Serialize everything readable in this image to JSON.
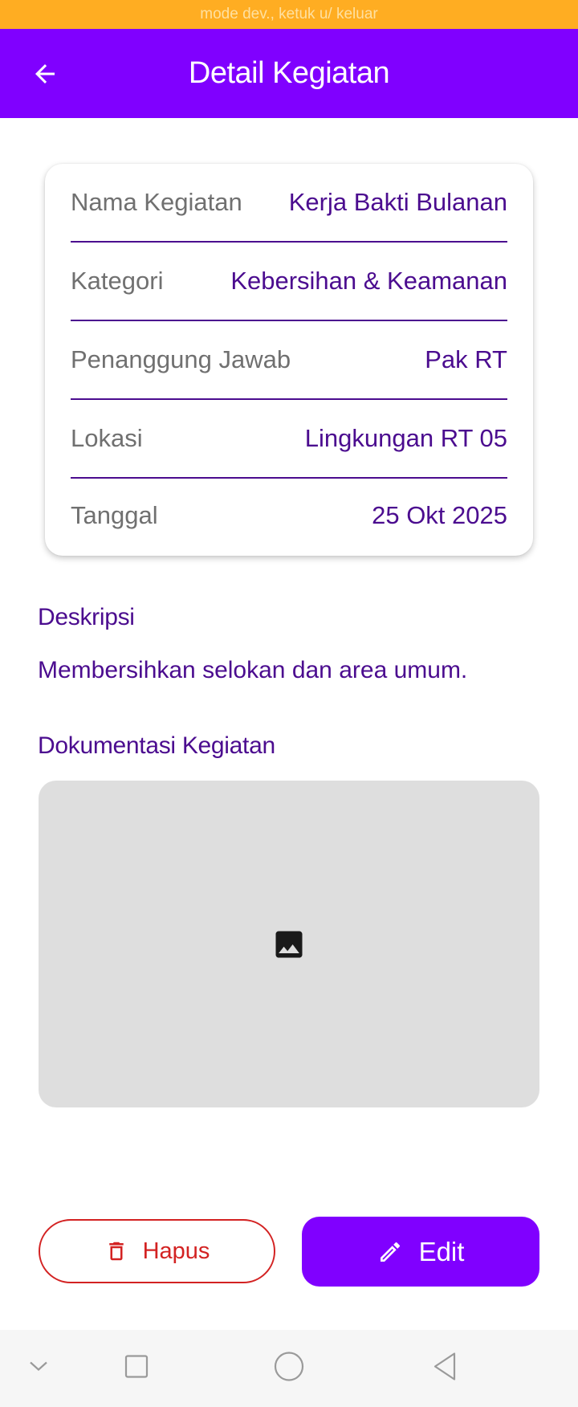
{
  "dev_banner": {
    "text": "mode dev., ketuk u/ keluar"
  },
  "app_bar": {
    "title": "Detail Kegiatan",
    "back_icon": "arrow-left-icon"
  },
  "colors": {
    "primary": "#8000FF",
    "text_purple": "#4B0C8F",
    "danger": "#D32222",
    "banner": "#FFAD22"
  },
  "details": {
    "rows": [
      {
        "label": "Nama Kegiatan",
        "value": "Kerja Bakti Bulanan"
      },
      {
        "label": "Kategori",
        "value": "Kebersihan & Keamanan"
      },
      {
        "label": "Penanggung Jawab",
        "value": "Pak RT"
      },
      {
        "label": "Lokasi",
        "value": "Lingkungan RT 05"
      },
      {
        "label": "Tanggal",
        "value": "25 Okt 2025"
      }
    ]
  },
  "description": {
    "title": "Deskripsi",
    "text": "Membersihkan selokan dan area umum."
  },
  "documentation": {
    "title": "Dokumentasi Kegiatan",
    "placeholder_icon": "image-icon"
  },
  "actions": {
    "delete_label": "Hapus",
    "delete_icon": "trash-icon",
    "edit_label": "Edit",
    "edit_icon": "pencil-icon"
  },
  "system_nav": {
    "items": [
      "chevron-down-icon",
      "square-icon",
      "circle-icon",
      "triangle-back-icon"
    ]
  }
}
